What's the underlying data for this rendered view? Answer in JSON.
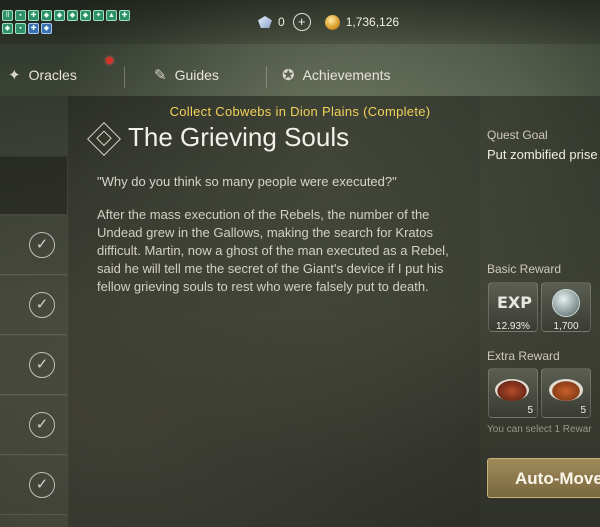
{
  "currency": {
    "gems": "0",
    "gold": "1,736,126"
  },
  "tabs": [
    {
      "label": "Oracles",
      "icon": "oracles-icon"
    },
    {
      "label": "Guides",
      "icon": "guides-icon"
    },
    {
      "label": "Achievements",
      "icon": "achievements-icon"
    }
  ],
  "quest": {
    "subtitle": "Collect Cobwebs in Dion Plains (Complete)",
    "title": "The Grieving Souls",
    "quote": "\"Why do you think so many people were executed?\"",
    "description": "After the mass execution of the Rebels, the number of the Undead grew in the Gallows, making the search for Kratos difficult. Martin, now a ghost of the man executed as a Rebel, said he will tell me the secret of the Giant's device if I put his fellow grieving souls to rest who were falsely put to death."
  },
  "side": {
    "goal_label": "Quest Goal",
    "goal_text": "Put zombified prise",
    "basic_reward_label": "Basic Reward",
    "basic_rewards": [
      {
        "icon": "exp-icon",
        "icon_text": "EXP",
        "value": "12.93%"
      },
      {
        "icon": "silver-coin-icon",
        "value": "1,700"
      }
    ],
    "extra_reward_label": "Extra Reward",
    "extra_rewards": [
      {
        "icon": "steak-icon",
        "count": "5"
      },
      {
        "icon": "skewer-icon",
        "count": "5"
      }
    ],
    "select_note": "You can select 1 Rewar",
    "auto_move_label": "Auto-Move"
  },
  "colors": {
    "subtitle": "#f2d25a",
    "button": "#8c7648"
  }
}
